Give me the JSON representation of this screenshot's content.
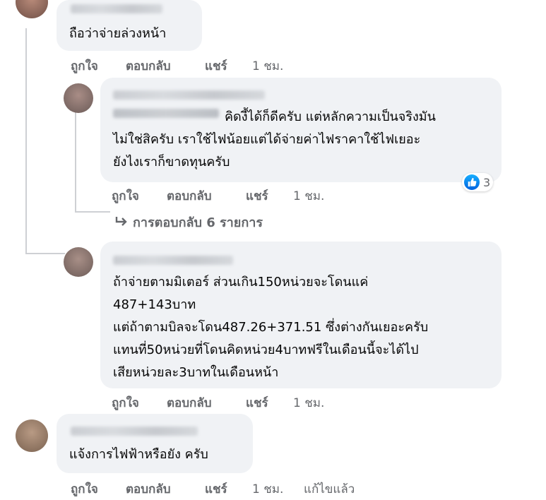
{
  "comments": [
    {
      "text_lines": [
        "ถือว่าจ่ายล่วงหน้า"
      ],
      "actions": {
        "like": "ถูกใจ",
        "reply": "ตอบกลับ",
        "share": "แชร์",
        "time": "1 ชม."
      }
    },
    {
      "text_lines": [
        "คิดงี้ได้ก็ดีครับ แต่หลักความเป็นจริงมัน",
        "ไม่ใช่สิครับ เราใช้ไฟน้อยแต่ได้จ่ายค่าไฟราคาใช้ไฟเยอะ",
        "ยังไงเราก็ขาดทุนครับ"
      ],
      "reaction": {
        "icon": "like-icon",
        "count": "3"
      },
      "actions": {
        "like": "ถูกใจ",
        "reply": "ตอบกลับ",
        "share": "แชร์",
        "time": "1 ชม."
      },
      "replies_link": "การตอบกลับ 6 รายการ"
    },
    {
      "text_lines": [
        "ถ้าจ่ายตามมิเตอร์ ส่วนเกิน150หน่วยจะโดนแค่",
        "487+143บาท",
        "แต่ถ้าตามบิลจะโดน487.26+371.51 ซึ่งต่างกันเยอะครับ",
        "แทนที่50หน่วยที่โดนคิดหน่วย4บาทฟรีในเดือนนี้จะได้ไป",
        "เสียหน่วยละ3บาทในเดือนหน้า"
      ],
      "actions": {
        "like": "ถูกใจ",
        "reply": "ตอบกลับ",
        "share": "แชร์",
        "time": "1 ชม."
      }
    },
    {
      "text_lines": [
        "แจ้งการไฟฟ้าหรือยัง ครับ"
      ],
      "actions": {
        "like": "ถูกใจ",
        "reply": "ตอบกลับ",
        "share": "แชร์",
        "time": "1 ชม.",
        "edited": "แก้ไขแล้ว"
      }
    }
  ],
  "colors": {
    "bubble": "#f0f2f5",
    "action_text": "#65676b",
    "like_blue": "#1877f2"
  }
}
